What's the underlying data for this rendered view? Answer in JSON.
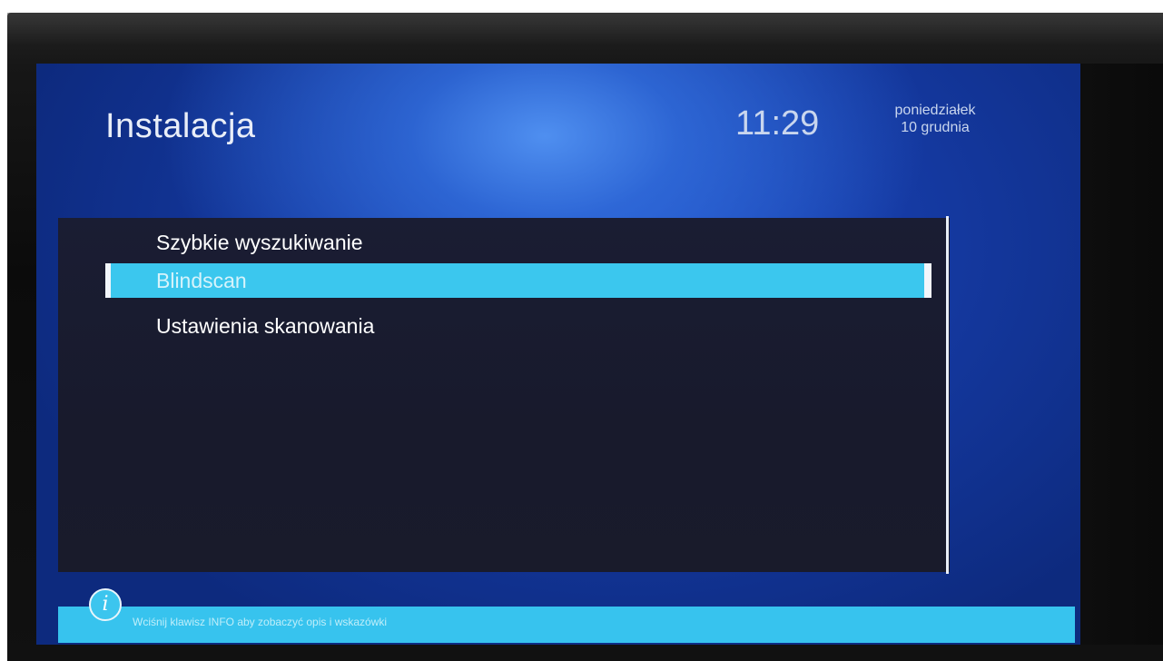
{
  "header": {
    "title": "Instalacja",
    "time": "11:29",
    "day": "poniedziałek",
    "date": "10 grudnia"
  },
  "menu": {
    "items": [
      {
        "label": "Szybkie wyszukiwanie",
        "selected": false
      },
      {
        "label": "Blindscan",
        "selected": true
      },
      {
        "label": "Ustawienia skanowania",
        "selected": false
      }
    ]
  },
  "footer": {
    "info_icon": "info-icon",
    "hint": "Wciśnij klawisz INFO aby zobaczyć opis i wskazówki"
  },
  "colors": {
    "accent": "#3bc7ee",
    "background": "#153aa3",
    "panel": "#1a1d33"
  }
}
